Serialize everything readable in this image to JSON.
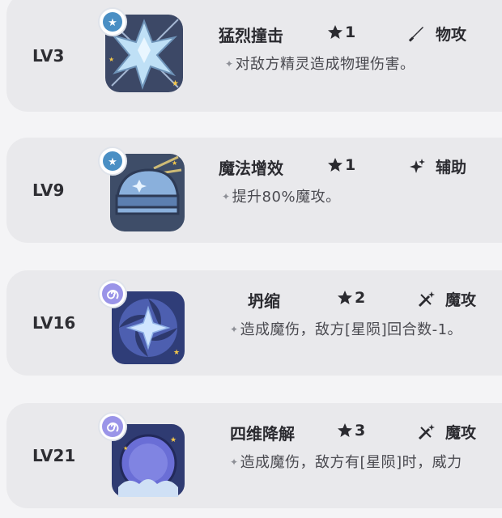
{
  "skills": [
    {
      "level": "LV3",
      "name": "猛烈撞击",
      "stars": "1",
      "category": "物攻",
      "category_icon": "sword-icon",
      "description": "对敌方精灵造成物理伤害。",
      "badge": "star-badge-icon"
    },
    {
      "level": "LV9",
      "name": "魔法增效",
      "stars": "1",
      "category": "辅助",
      "category_icon": "sparkle-icon",
      "description": "提升80%魔攻。",
      "badge": "star-badge-icon"
    },
    {
      "level": "LV16",
      "name": "坍缩",
      "stars": "2",
      "category": "魔攻",
      "category_icon": "magic-wand-icon",
      "description": "造成魔伤，敌方[星陨]回合数-1。",
      "badge": "swirl-badge-icon"
    },
    {
      "level": "LV21",
      "name": "四维降解",
      "stars": "3",
      "category": "魔攻",
      "category_icon": "magic-wand-icon",
      "description": "造成魔伤，敌方有[星陨]时，威力",
      "badge": "swirl-badge-icon"
    }
  ],
  "colors": {
    "card_bg": "#e9e9ec",
    "page_bg": "#f4f4f6",
    "badge_star": "#4a8fc4",
    "badge_swirl": "#9a94e8",
    "text": "#2b2b30"
  }
}
